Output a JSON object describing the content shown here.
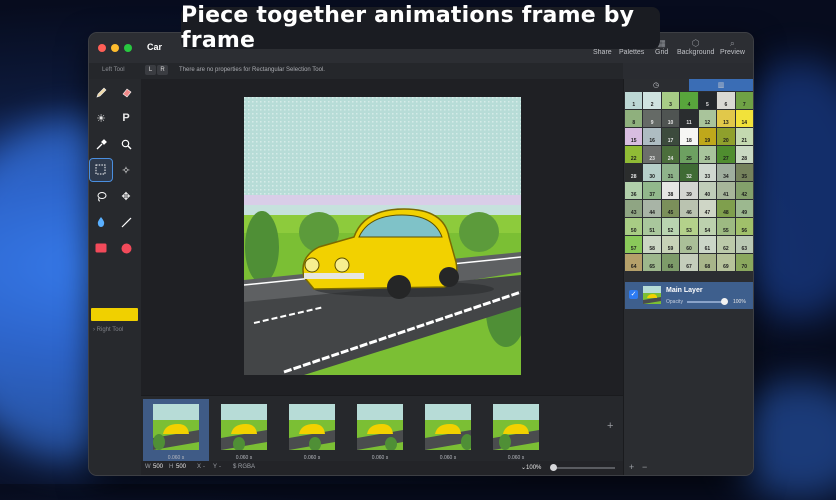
{
  "headline": "Piece together animations frame by frame",
  "window": {
    "title": "Car",
    "traffic_colors": [
      "#ff5f57",
      "#febc2e",
      "#28c840"
    ]
  },
  "toolbar": {
    "share": "Share",
    "palettes": "Palettes",
    "grid": "Grid",
    "background": "Background",
    "preview": "Preview"
  },
  "properties": {
    "left_tool_label": "Left Tool",
    "l_button": "L",
    "r_button": "R",
    "message": "There are no properties for Rectangular Selection Tool."
  },
  "tools": {
    "pencil": "pencil-icon",
    "eraser": "eraser-icon",
    "brightness": "brightness-icon",
    "pixel": "P",
    "eyedropper": "eyedropper-icon",
    "zoom": "zoom-icon",
    "rect_select": "rectangular-selection-icon",
    "magic_wand": "magic-wand-icon",
    "lasso": "lasso-icon",
    "move": "move-icon",
    "fill": "fill-bucket-icon",
    "line": "line-icon",
    "rectangle": "rectangle-icon",
    "circle": "circle-icon",
    "current_color": "#f0d000",
    "right_tool_label": "Right Tool"
  },
  "frames": [
    {
      "duration": "0.060 s"
    },
    {
      "duration": "0.060 s"
    },
    {
      "duration": "0.060 s"
    },
    {
      "duration": "0.060 s"
    },
    {
      "duration": "0.060 s"
    },
    {
      "duration": "0.060 s"
    }
  ],
  "status": {
    "w_label": "W",
    "w_value": "500",
    "h_label": "H",
    "h_value": "500",
    "x_label": "X",
    "x_value": "-",
    "y_label": "Y",
    "y_value": "-",
    "color_format": "$ RGBA",
    "zoom": "100%"
  },
  "palette": [
    {
      "n": "1",
      "c": "#bcd7d4"
    },
    {
      "n": "2",
      "c": "#cfe3e0"
    },
    {
      "n": "3",
      "c": "#a7cc86"
    },
    {
      "n": "4",
      "c": "#58a53c"
    },
    {
      "n": "5",
      "c": "#23272b"
    },
    {
      "n": "6",
      "c": "#d9d9d3"
    },
    {
      "n": "7",
      "c": "#6fa145"
    },
    {
      "n": "8",
      "c": "#8fb07d"
    },
    {
      "n": "9",
      "c": "#656a66"
    },
    {
      "n": "10",
      "c": "#4f5452"
    },
    {
      "n": "11",
      "c": "#2a2d2f"
    },
    {
      "n": "12",
      "c": "#a9c49b"
    },
    {
      "n": "13",
      "c": "#e1c84a"
    },
    {
      "n": "14",
      "c": "#f2e23a"
    },
    {
      "n": "15",
      "c": "#d8bde0"
    },
    {
      "n": "16",
      "c": "#aebcc2"
    },
    {
      "n": "17",
      "c": "#3c4b3d"
    },
    {
      "n": "18",
      "c": "#f6f6f4"
    },
    {
      "n": "19",
      "c": "#bfa81b"
    },
    {
      "n": "20",
      "c": "#8fa02c"
    },
    {
      "n": "21",
      "c": "#c4d9b0"
    },
    {
      "n": "22",
      "c": "#90bb35"
    },
    {
      "n": "23",
      "c": "#6c6e6c"
    },
    {
      "n": "24",
      "c": "#4b6e3b"
    },
    {
      "n": "25",
      "c": "#6da061"
    },
    {
      "n": "26",
      "c": "#a8c49c"
    },
    {
      "n": "27",
      "c": "#4f8d2f"
    },
    {
      "n": "28",
      "c": "#c9d9c3"
    },
    {
      "n": "28",
      "c": "#2b2d2d"
    },
    {
      "n": "30",
      "c": "#b6cfc9"
    },
    {
      "n": "31",
      "c": "#8eb38a"
    },
    {
      "n": "32",
      "c": "#3f6b34"
    },
    {
      "n": "33",
      "c": "#cfd8cf"
    },
    {
      "n": "34",
      "c": "#9fae9e"
    },
    {
      "n": "35",
      "c": "#75825c"
    },
    {
      "n": "36",
      "c": "#b1cfaa"
    },
    {
      "n": "37",
      "c": "#92b88c"
    },
    {
      "n": "38",
      "c": "#e6e6e4"
    },
    {
      "n": "39",
      "c": "#d3d5d2"
    },
    {
      "n": "40",
      "c": "#c0cdb9"
    },
    {
      "n": "41",
      "c": "#a7b69a"
    },
    {
      "n": "42",
      "c": "#83a06b"
    },
    {
      "n": "43",
      "c": "#8fa583"
    },
    {
      "n": "44",
      "c": "#a8b4a6"
    },
    {
      "n": "45",
      "c": "#7b8f5a"
    },
    {
      "n": "46",
      "c": "#bac3b0"
    },
    {
      "n": "47",
      "c": "#cfd6c6"
    },
    {
      "n": "48",
      "c": "#7f9f4d"
    },
    {
      "n": "49",
      "c": "#9cb88f"
    },
    {
      "n": "50",
      "c": "#a8cc84"
    },
    {
      "n": "51",
      "c": "#a9c79c"
    },
    {
      "n": "52",
      "c": "#b9d4b0"
    },
    {
      "n": "53",
      "c": "#b4d18b"
    },
    {
      "n": "54",
      "c": "#bcd1ae"
    },
    {
      "n": "55",
      "c": "#9dba82"
    },
    {
      "n": "56",
      "c": "#a0c06a"
    },
    {
      "n": "57",
      "c": "#8ac95a"
    },
    {
      "n": "58",
      "c": "#cbd6c4"
    },
    {
      "n": "59",
      "c": "#c7d2b7"
    },
    {
      "n": "60",
      "c": "#aabf98"
    },
    {
      "n": "61",
      "c": "#cbd6c8"
    },
    {
      "n": "62",
      "c": "#bccaaa"
    },
    {
      "n": "63",
      "c": "#b9c8b3"
    },
    {
      "n": "64",
      "c": "#b5a06a"
    },
    {
      "n": "65",
      "c": "#9db78c"
    },
    {
      "n": "66",
      "c": "#7d9b69"
    },
    {
      "n": "67",
      "c": "#c4cdbb"
    },
    {
      "n": "68",
      "c": "#a8b58a"
    },
    {
      "n": "69",
      "c": "#b7c39b"
    },
    {
      "n": "70",
      "c": "#8aa85e"
    }
  ],
  "layer": {
    "name": "Main Layer",
    "opacity_label": "Opacity",
    "opacity_value": "100%",
    "opacity_fraction": 1.0
  },
  "right_footer": {
    "add": "+",
    "remove": "−"
  }
}
